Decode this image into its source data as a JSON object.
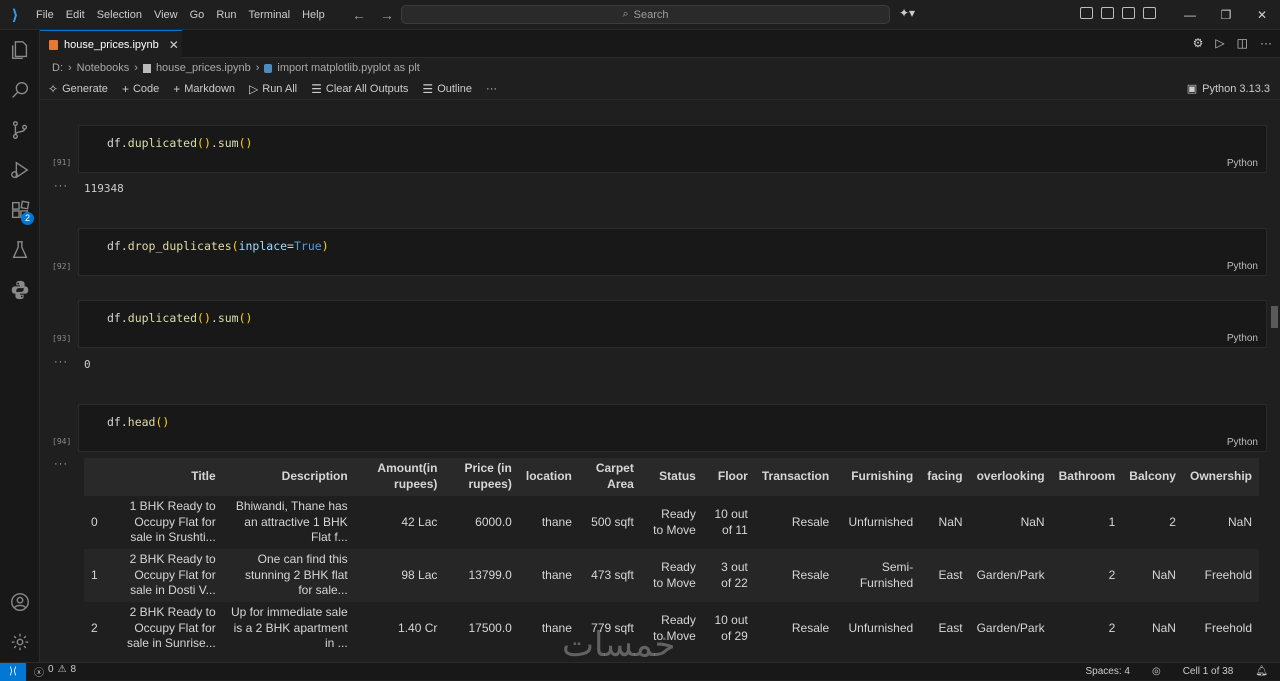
{
  "menu": [
    "File",
    "Edit",
    "Selection",
    "View",
    "Go",
    "Run",
    "Terminal",
    "Help"
  ],
  "search_placeholder": "Search",
  "tab": {
    "name": "house_prices.ipynb",
    "close": "✕"
  },
  "breadcrumb": {
    "drive": "D:",
    "folder": "Notebooks",
    "file": "house_prices.ipynb",
    "symbol": "import matplotlib.pyplot as plt"
  },
  "toolbar": {
    "generate": "Generate",
    "code": "Code",
    "markdown": "Markdown",
    "run_all": "Run All",
    "clear": "Clear All Outputs",
    "outline": "Outline",
    "more": "···",
    "kernel": "Python 3.13.3"
  },
  "activity_badge": "2",
  "cells": [
    {
      "exec": "[91]",
      "lang": "Python",
      "output": "119348"
    },
    {
      "exec": "[92]",
      "lang": "Python"
    },
    {
      "exec": "[93]",
      "lang": "Python",
      "output": "0"
    },
    {
      "exec": "[94]",
      "lang": "Python"
    }
  ],
  "out_dots": "···",
  "table": {
    "headers": [
      "",
      "Title",
      "Description",
      "Amount(in rupees)",
      "Price (in rupees)",
      "location",
      "Carpet Area",
      "Status",
      "Floor",
      "Transaction",
      "Furnishing",
      "facing",
      "overlooking",
      "Bathroom",
      "Balcony",
      "Ownership"
    ],
    "rows": [
      [
        "0",
        "1 BHK Ready to Occupy Flat for sale in Srushti...",
        "Bhiwandi, Thane has an attractive 1 BHK Flat f...",
        "42 Lac",
        "6000.0",
        "thane",
        "500 sqft",
        "Ready to Move",
        "10 out of 11",
        "Resale",
        "Unfurnished",
        "NaN",
        "NaN",
        "1",
        "2",
        "NaN"
      ],
      [
        "1",
        "2 BHK Ready to Occupy Flat for sale in Dosti V...",
        "One can find this stunning 2 BHK flat for sale...",
        "98 Lac",
        "13799.0",
        "thane",
        "473 sqft",
        "Ready to Move",
        "3 out of 22",
        "Resale",
        "Semi-Furnished",
        "East",
        "Garden/Park",
        "2",
        "NaN",
        "Freehold"
      ],
      [
        "2",
        "2 BHK Ready to Occupy Flat for sale in Sunrise...",
        "Up for immediate sale is a 2 BHK apartment in ...",
        "1.40 Cr",
        "17500.0",
        "thane",
        "779 sqft",
        "Ready to Move",
        "10 out of 29",
        "Resale",
        "Unfurnished",
        "East",
        "Garden/Park",
        "2",
        "NaN",
        "Freehold"
      ]
    ]
  },
  "status": {
    "errors": "0",
    "warnings": "8",
    "spaces": "Spaces: 4",
    "cell": "Cell 1 of 38"
  },
  "watermark": "خمسات",
  "colors": {
    "accent": "#0078d4",
    "background": "#1f1f1f"
  }
}
